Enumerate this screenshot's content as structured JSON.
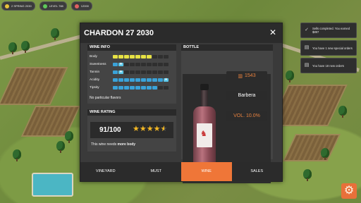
{
  "hud": {
    "items": [
      {
        "text": "2 SPRING 2030",
        "color": "#e8c23a"
      },
      {
        "text": "LEVEL 788",
        "color": "#5ec85a"
      },
      {
        "text": "12000",
        "color": "#e06060"
      }
    ]
  },
  "modal": {
    "title": "CHARDON 27 2030",
    "close_label": "✕"
  },
  "wine_info": {
    "title": "WINE INFO",
    "attributes": [
      {
        "label": "Body",
        "level": 0.7
      },
      {
        "label": "Sweetness",
        "level": 0.2
      },
      {
        "label": "Tannin",
        "level": 0.2
      },
      {
        "label": "Acidity",
        "level": 1.0
      },
      {
        "label": "Tipsity",
        "level": 0.8
      }
    ],
    "flavors_text": "No particular flavors"
  },
  "wine_rating": {
    "title": "WINE RATING",
    "score": "91/100",
    "stars": 4.5,
    "need_prefix": "This wine needs ",
    "need_strong": "more body"
  },
  "bottle": {
    "title": "BOTTLE",
    "count": "1543",
    "grape": "Barbera",
    "vol": "VOL. 10.0%"
  },
  "tabs": [
    {
      "label": "VINEYARD",
      "active": false
    },
    {
      "label": "MUST",
      "active": false
    },
    {
      "label": "WINE",
      "active": true
    },
    {
      "label": "SALES",
      "active": false
    }
  ],
  "notifications": [
    {
      "icon": "check-icon",
      "text": "Sells completed. You earned $897"
    },
    {
      "icon": "doc-icon",
      "text": "You have 1 new special orders"
    },
    {
      "icon": "doc-icon",
      "text": "You have 18 new orders"
    }
  ],
  "colors": {
    "accent": "#ef7638",
    "body_bar": "#e7e244",
    "other_bar": "#3aa2d8",
    "star": "#f4b824"
  }
}
